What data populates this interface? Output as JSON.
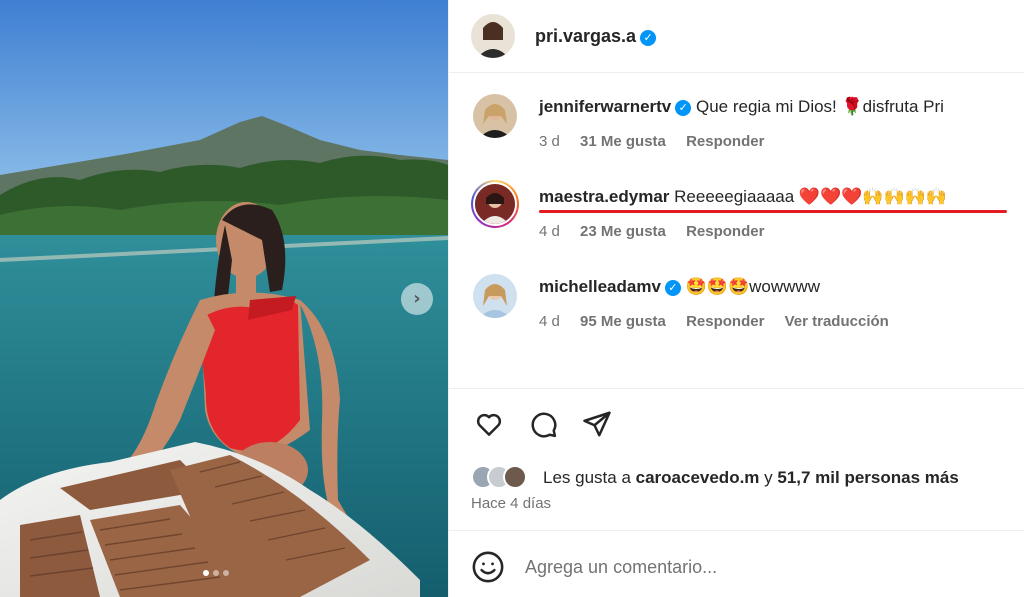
{
  "author": {
    "username": "pri.vargas.a",
    "verified": true
  },
  "comments": [
    {
      "username": "jennifer­warnertv",
      "verified": true,
      "text": "Que regia mi Dios! 🌹disfruta Pri",
      "age": "3 d",
      "likes": "31 Me gusta",
      "reply": "Responder"
    },
    {
      "username": "maestra.edymar",
      "verified": false,
      "text": "Reeeeegiaaaaa ❤️❤️❤️🙌🙌🙌🙌",
      "age": "4 d",
      "likes": "23 Me gusta",
      "reply": "Responder"
    },
    {
      "username": "michelleadamv",
      "verified": true,
      "text": "🤩🤩🤩wowwww",
      "age": "4 d",
      "likes": "95 Me gusta",
      "reply": "Responder",
      "translate": "Ver traducción"
    }
  ],
  "likes": {
    "prefix": "Les gusta a ",
    "liker": "caroacevedo.m",
    "joiner": " y ",
    "others": "51,7 mil personas más"
  },
  "posted": "Hace 4 días",
  "comment_box": {
    "placeholder": "Agrega un comentario..."
  },
  "icons": [
    "heart-icon",
    "comment-icon",
    "share-icon",
    "emoji-icon",
    "chevron-right-icon",
    "verified-icon"
  ],
  "colors": {
    "highlight": "#e31b23",
    "verified": "#0095f6",
    "muted": "#737373"
  }
}
